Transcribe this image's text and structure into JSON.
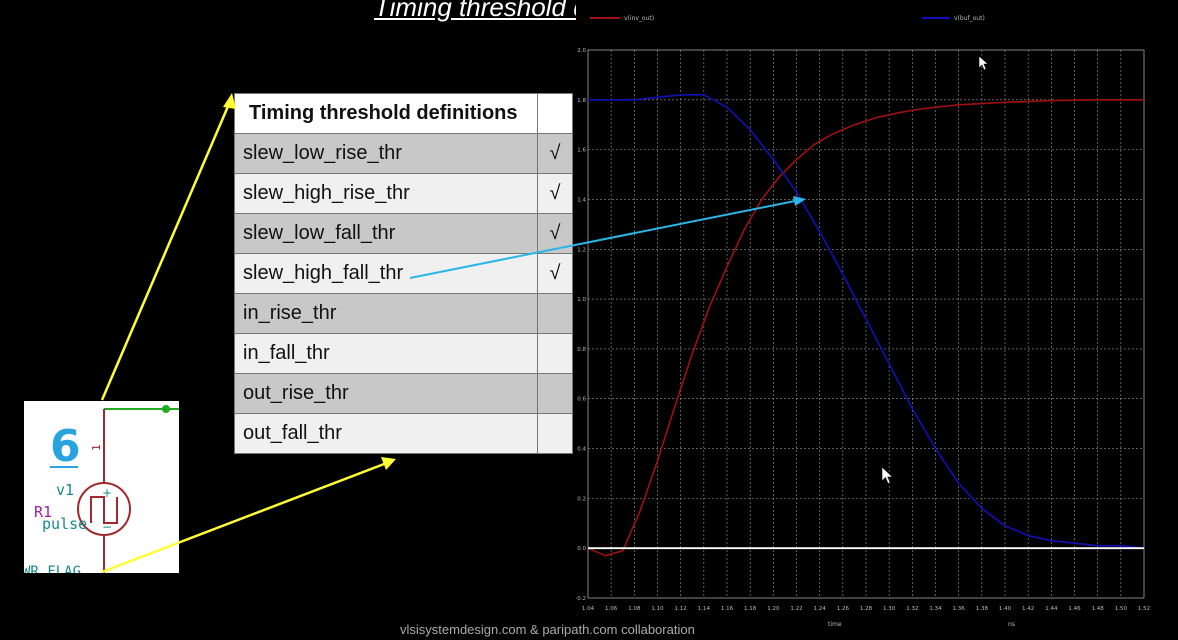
{
  "slide": {
    "title": "Timing threshold definitions",
    "footer": "vlsisystemdesign.com & paripath.com collaboration"
  },
  "table": {
    "header": "Timing threshold definitions",
    "rows": [
      {
        "label": "slew_low_rise_thr",
        "check": "√"
      },
      {
        "label": "slew_high_rise_thr",
        "check": "√"
      },
      {
        "label": "slew_low_fall_thr",
        "check": "√"
      },
      {
        "label": "slew_high_fall_thr",
        "check": "√"
      },
      {
        "label": "in_rise_thr",
        "check": ""
      },
      {
        "label": "in_fall_thr",
        "check": ""
      },
      {
        "label": "out_rise_thr",
        "check": ""
      },
      {
        "label": "out_fall_thr",
        "check": ""
      }
    ]
  },
  "schematic": {
    "number": "6",
    "ref": "R1",
    "source_name": "v1",
    "source_type": "pulse",
    "plus_sign": "+",
    "minus_sign": "−",
    "pin_label": "1",
    "flag_label": "WR_FLAG"
  },
  "colors": {
    "arrow_yellow": "#ffff33",
    "arrow_cyan": "#29b6e8",
    "red_trace": "#a01010",
    "blue_trace": "#1010b8",
    "grid": "#9a9a9a",
    "schematic_blue": "#29a3e0",
    "wire_green": "#22aa22",
    "schematic_red": "#a0282e",
    "teal": "#168a8a",
    "purple": "#a020a0"
  },
  "chart_data": {
    "type": "line",
    "legend": [
      "v(inv_out)",
      "v(buf_out)"
    ],
    "xlabel": "time",
    "x_unit": "ns",
    "x_ticks": [
      "1.04",
      "1.06",
      "1.08",
      "1.10",
      "1.12",
      "1.14",
      "1.16",
      "1.18",
      "1.20",
      "1.22",
      "1.24",
      "1.26",
      "1.28",
      "1.30",
      "1.32",
      "1.34",
      "1.36",
      "1.38",
      "1.40",
      "1.42",
      "1.44",
      "1.46",
      "1.48",
      "1.50",
      "1.52"
    ],
    "y_ticks": [
      "2.0",
      "1.8",
      "1.6",
      "1.4",
      "1.2",
      "1.0",
      "0.8",
      "0.6",
      "0.4",
      "0.2",
      "0.0",
      "-0.2"
    ],
    "xlim": [
      1.04,
      1.52
    ],
    "ylim": [
      -0.2,
      2.0
    ],
    "grid": true,
    "series": [
      {
        "name": "v(inv_out)",
        "color": "#a01010",
        "x": [
          1.04,
          1.055,
          1.07,
          1.085,
          1.1,
          1.115,
          1.13,
          1.145,
          1.16,
          1.175,
          1.19,
          1.205,
          1.22,
          1.235,
          1.25,
          1.27,
          1.29,
          1.31,
          1.33,
          1.36,
          1.4,
          1.44,
          1.48,
          1.52
        ],
        "y": [
          0.0,
          -0.03,
          -0.01,
          0.15,
          0.35,
          0.57,
          0.78,
          0.97,
          1.13,
          1.28,
          1.4,
          1.49,
          1.56,
          1.62,
          1.66,
          1.7,
          1.73,
          1.75,
          1.765,
          1.78,
          1.79,
          1.797,
          1.8,
          1.8
        ]
      },
      {
        "name": "v(buf_out)",
        "color": "#1010b8",
        "x": [
          1.04,
          1.06,
          1.08,
          1.1,
          1.12,
          1.14,
          1.16,
          1.18,
          1.2,
          1.22,
          1.24,
          1.26,
          1.28,
          1.3,
          1.32,
          1.34,
          1.36,
          1.38,
          1.4,
          1.42,
          1.44,
          1.46,
          1.48,
          1.5,
          1.52
        ],
        "y": [
          1.8,
          1.8,
          1.8,
          1.81,
          1.82,
          1.82,
          1.77,
          1.68,
          1.56,
          1.43,
          1.27,
          1.1,
          0.92,
          0.74,
          0.56,
          0.4,
          0.26,
          0.16,
          0.09,
          0.05,
          0.03,
          0.02,
          0.01,
          0.01,
          0.0
        ]
      },
      {
        "name": "",
        "color": "#ffffff",
        "x": [
          1.04,
          1.52
        ],
        "y": [
          0.0,
          0.0
        ]
      }
    ]
  }
}
